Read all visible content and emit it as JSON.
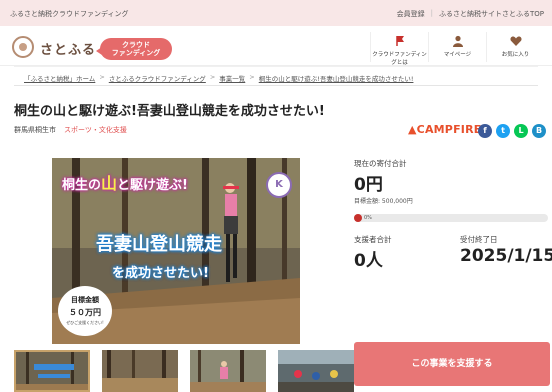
{
  "topbar": {
    "tagline": "ふるさと納税クラウドファンディング",
    "links": [
      "会員登録",
      "ふるさと納税サイトさとふるTOP"
    ]
  },
  "header": {
    "logo": "さとふる",
    "cf_badge_line1": "クラウド",
    "cf_badge_line2": "ファンディング",
    "nav": [
      {
        "label": "クラウドファンディングとは",
        "icon": "flag-icon"
      },
      {
        "label": "マイページ",
        "icon": "person-icon"
      },
      {
        "label": "お気に入り",
        "icon": "heart-icon"
      }
    ]
  },
  "breadcrumb": [
    "「ふるさと納税」ホーム",
    "さとふるクラウドファンディング",
    "事業一覧",
    "桐生の山と駆け遊ぶ!吾妻山登山競走を成功させたい!"
  ],
  "project": {
    "title": "桐生の山と駆け遊ぶ!吾妻山登山競走を成功させたい!",
    "location": "群馬県桐生市",
    "category": "スポーツ・文化支援",
    "platform": "CAMPFIRE"
  },
  "hero": {
    "line1_pre": "桐生の",
    "line1_em": "山",
    "line1_post": "と駆け遊ぶ!",
    "line2": "吾妻山登山競走",
    "line3": "を成功させたい!",
    "goal_label": "目標金額",
    "goal_value": "５０万円",
    "goal_note": "ぜひご支援ください!",
    "badge": "K"
  },
  "stats": {
    "donation_label": "現在の寄付合計",
    "donation_value": "0円",
    "target_label": "目標金額: 500,000円",
    "progress_percent": 0,
    "progress_text": "0%",
    "supporters_label": "支援者合計",
    "supporters_value": "0人",
    "end_label": "受付終了日",
    "end_value": "2025/1/15"
  },
  "cta": {
    "support_label": "この事業を支援する"
  },
  "colors": {
    "accent": "#e87676",
    "campfire": "#e8502c",
    "category": "#e05050",
    "progress": "#c7302c"
  }
}
